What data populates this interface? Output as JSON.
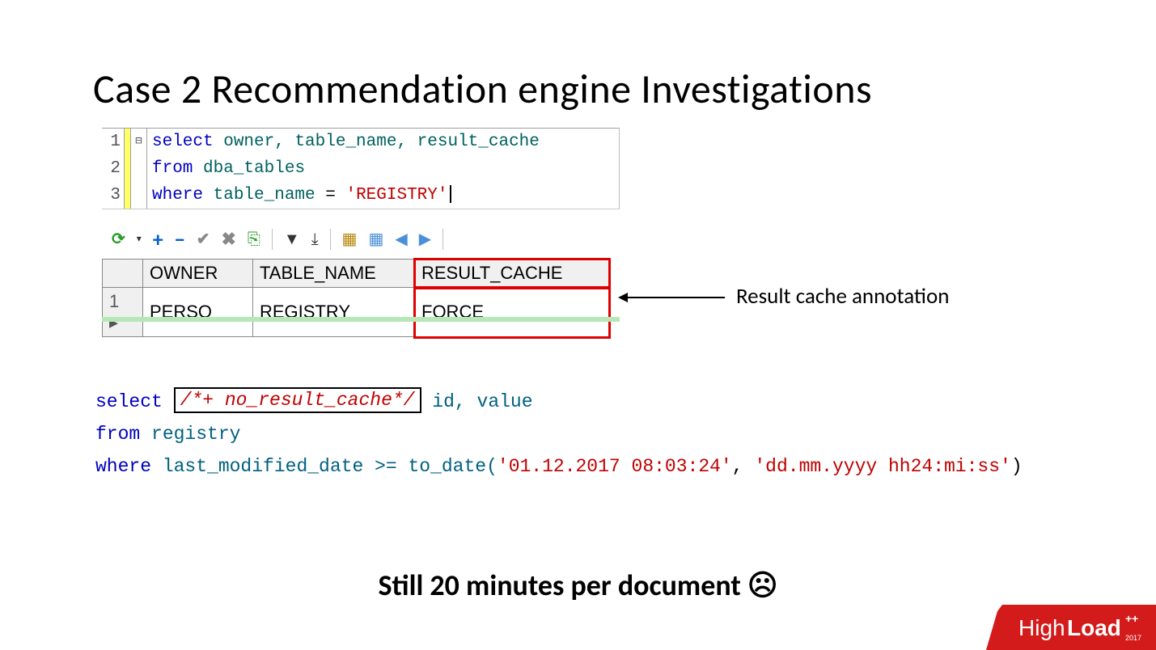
{
  "title": "Case 2 Recommendation engine Investigations",
  "sql1": {
    "line1_kw1": "select",
    "line1_ids": " owner, table_name, result_cache",
    "line2_kw": "from",
    "line2_id": " dba_tables",
    "line3_kw": "where",
    "line3_id": " table_name ",
    "line3_eq": "= ",
    "line3_str": "'REGISTRY'"
  },
  "toolbar": {
    "refresh": "⟳",
    "dropdown": "▾",
    "plus": "+",
    "minus": "−",
    "check": "✔",
    "x": "✖",
    "box": "⎘",
    "tridown": "▼",
    "tribar": "⤓",
    "grida": "▦",
    "gridb": "▦",
    "left": "◀",
    "right": "▶"
  },
  "table": {
    "headers": {
      "owner": "OWNER",
      "table_name": "TABLE_NAME",
      "result_cache": "RESULT_CACHE"
    },
    "row1": {
      "num": "1 ▸",
      "owner": "PERSO",
      "table_name": "REGISTRY",
      "result_cache": "FORCE"
    }
  },
  "annotation": "Result cache annotation",
  "sql2": {
    "select": "select",
    "hint": "/*+ no_result_cache*/",
    "cols": " id, value",
    "from": "from",
    "from_id": " registry",
    "where": "where",
    "where_rest": " last_modified_date >= to_date(",
    "date_str": "'01.12.2017 08:03:24'",
    "comma": ", ",
    "fmt_str": "'dd.mm.yyyy hh24:mi:ss'",
    "close": ")"
  },
  "bottom": "Still 20 minutes per document ☹",
  "logo": {
    "high": "High",
    "load": "Load",
    "plus": "++",
    "year": "2017"
  }
}
